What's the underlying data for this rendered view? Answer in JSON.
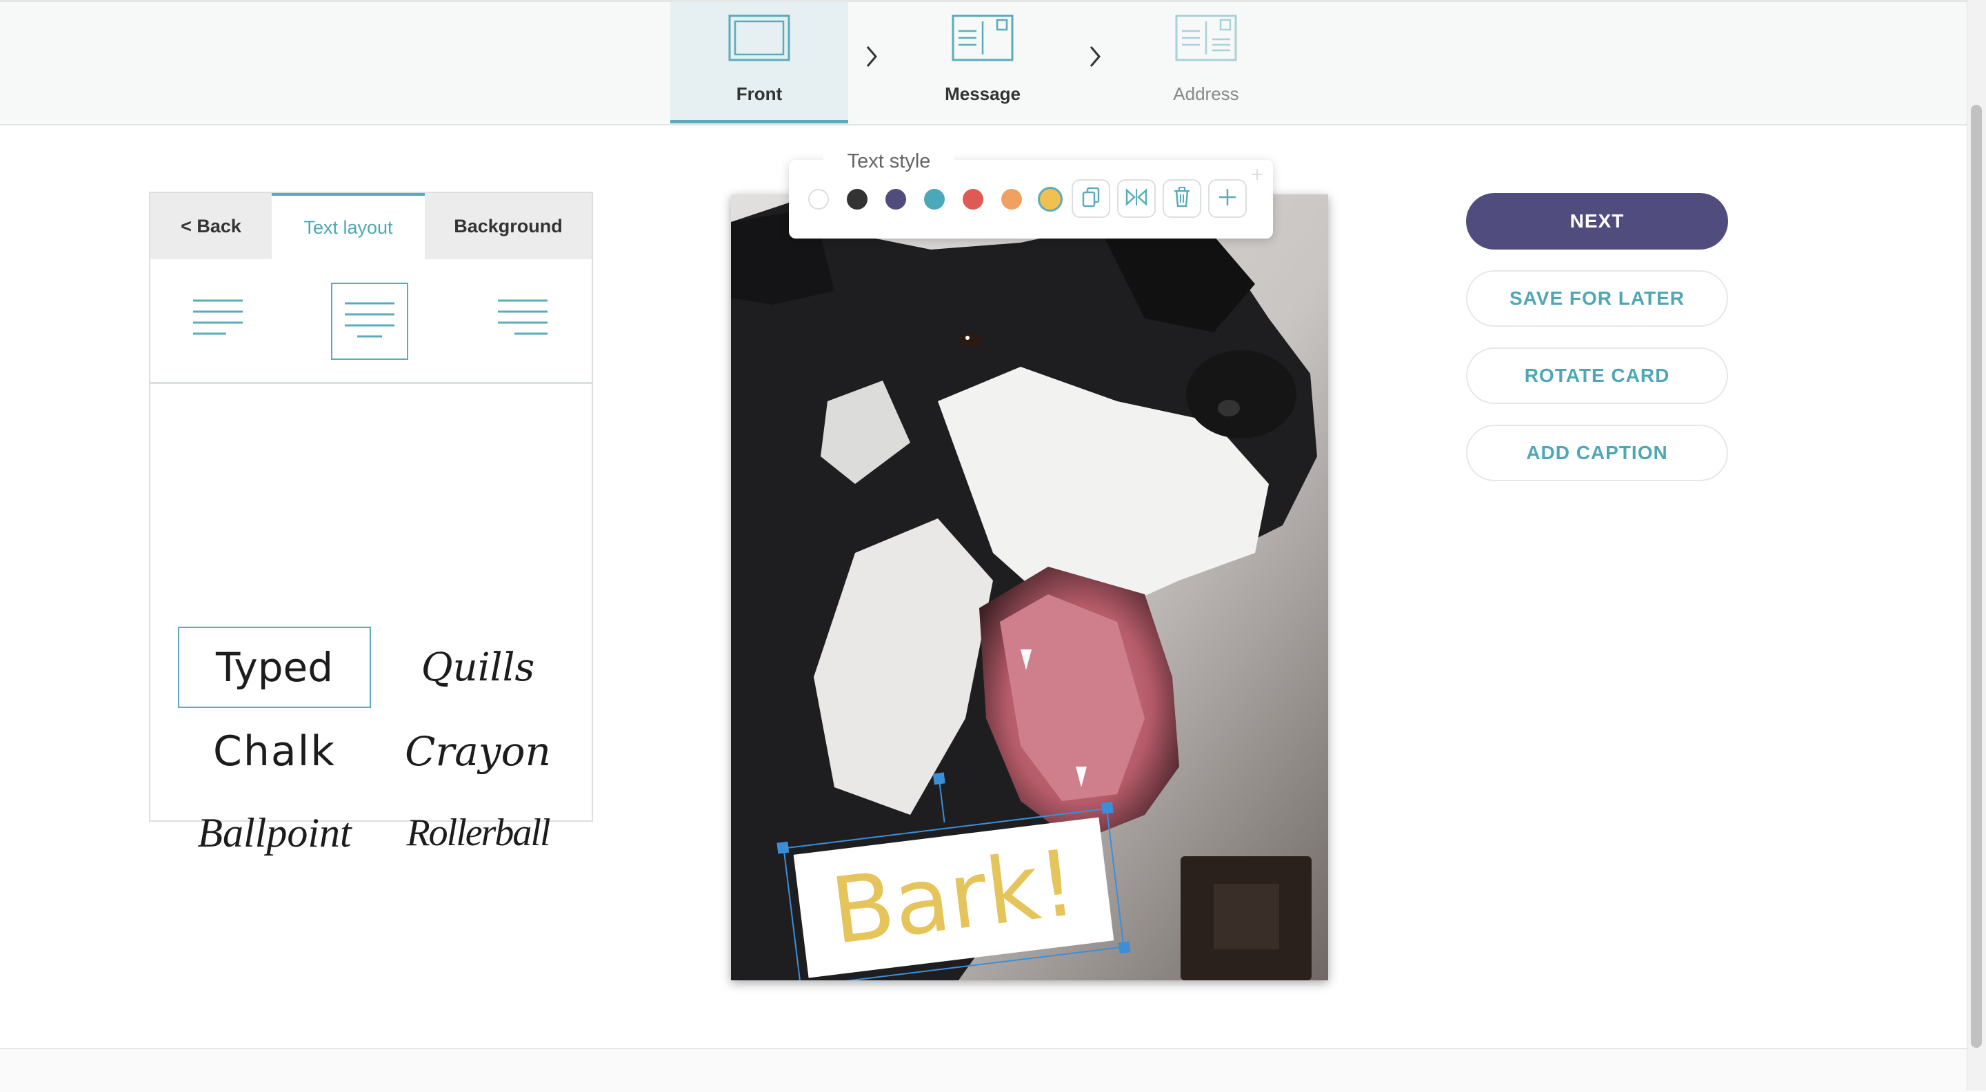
{
  "steps": [
    {
      "label": "Front",
      "state": "active"
    },
    {
      "label": "Message",
      "state": "next"
    },
    {
      "label": "Address",
      "state": "upcoming"
    }
  ],
  "editor": {
    "tabs": {
      "back": "< Back",
      "text_layout": "Text layout",
      "background": "Background"
    },
    "alignments": [
      "left",
      "center",
      "right"
    ],
    "selected_alignment": "center",
    "fonts": [
      "Typed",
      "Quills",
      "Chalk",
      "Crayon",
      "Ballpoint",
      "Rollerball"
    ],
    "selected_font": "Typed"
  },
  "toolbar": {
    "title": "Text style",
    "colors": [
      "#ffffff",
      "#333333",
      "#514c7e",
      "#4ba8b8",
      "#e05a55",
      "#f0a060",
      "#f0c050"
    ],
    "selected_color": "#f0c050",
    "icons": [
      "duplicate-icon",
      "flip-icon",
      "trash-icon",
      "plus-icon"
    ]
  },
  "card": {
    "caption_text": "Bark!",
    "caption_color": "#e6c45c"
  },
  "actions": {
    "next": "NEXT",
    "save": "SAVE FOR LATER",
    "rotate": "ROTATE CARD",
    "caption": "ADD CAPTION"
  },
  "colors": {
    "accent": "#5aacbc",
    "primary": "#514c7e"
  }
}
